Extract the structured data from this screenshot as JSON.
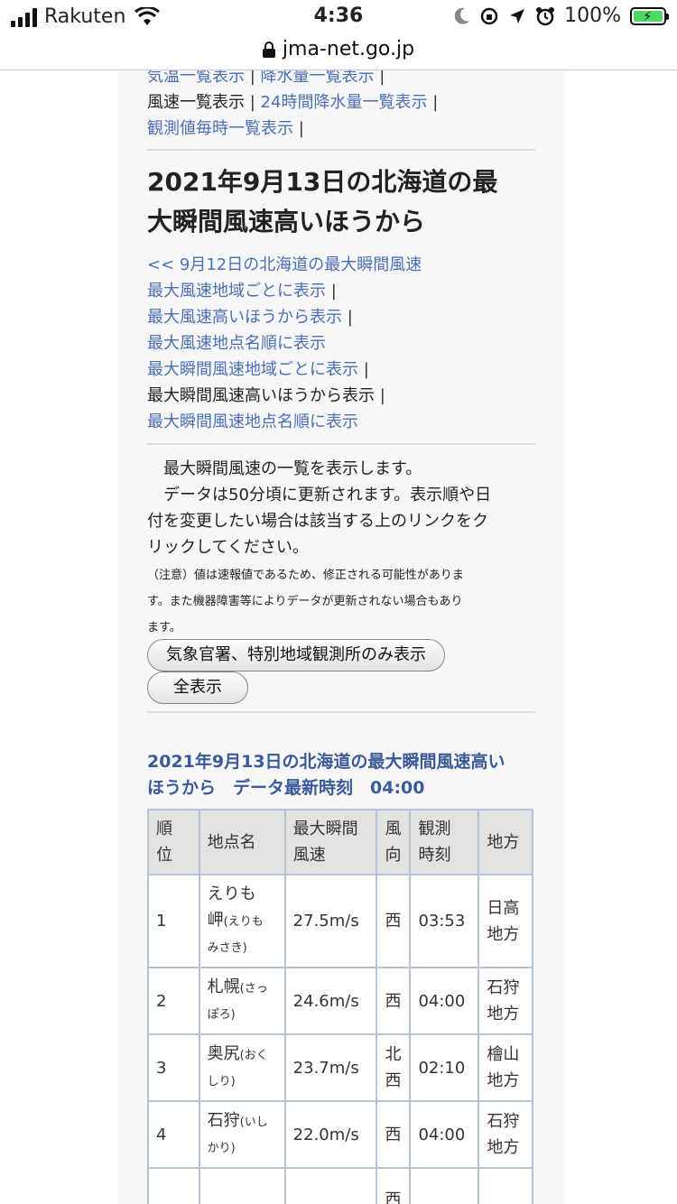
{
  "status": {
    "carrier": "Rakuten",
    "time": "4:36",
    "battery": "100%"
  },
  "url": "jma-net.go.jp",
  "top_nav": [
    [
      {
        "text": "気温一覧表示",
        "link": true
      },
      {
        "text": "|",
        "sep": true
      },
      {
        "text": "降水量一覧表示",
        "link": true
      },
      {
        "text": "|",
        "sep": true
      }
    ],
    [
      {
        "text": "風速一覧表示",
        "link": false
      },
      {
        "text": "|",
        "sep": true
      },
      {
        "text": "24時間降水量一覧表示",
        "link": true
      },
      {
        "text": "|",
        "sep": true
      }
    ],
    [
      {
        "text": "観測値毎時一覧表示",
        "link": true
      },
      {
        "text": "|",
        "sep": true
      }
    ]
  ],
  "title_lines": [
    "2021年9月13日の北海道の最",
    "大瞬間風速高いほうから"
  ],
  "display_nav": [
    {
      "text": "<< 9月12日の北海道の最大瞬間風速",
      "link": true,
      "sep": ""
    },
    {
      "text": "最大風速地域ごとに表示",
      "link": true,
      "sep": "|"
    },
    {
      "text": "最大風速高いほうから表示",
      "link": true,
      "sep": "|"
    },
    {
      "text": "最大風速地点名順に表示",
      "link": true,
      "sep": ""
    },
    {
      "text": "最大瞬間風速地域ごとに表示",
      "link": true,
      "sep": "|"
    },
    {
      "text": "最大瞬間風速高いほうから表示",
      "link": false,
      "sep": "|"
    },
    {
      "text": "最大瞬間風速地点名順に表示",
      "link": true,
      "sep": ""
    }
  ],
  "description_lines": [
    "　最大瞬間風速の一覧を表示します。",
    "　データは50分頃に更新されます。表示順や日",
    "付を変更したい場合は該当する上のリンクをク",
    "リックしてください。"
  ],
  "note_lines": [
    "（注意）値は速報値であるため、修正される可能性がありま",
    "す。また機器障害等によりデータが更新されない場合もあり",
    "ます。"
  ],
  "buttons": {
    "filter": "気象官署、特別地域観測所のみ表示",
    "all": "全表示"
  },
  "table_caption_lines": [
    "2021年9月13日の北海道の最大瞬間風速高い",
    "ほうから　データ最新時刻　04:00"
  ],
  "table": {
    "headers": [
      [
        "順",
        "位"
      ],
      [
        "地点名"
      ],
      [
        "最大瞬間",
        "風速"
      ],
      [
        "風",
        "向"
      ],
      [
        "観測",
        "時刻"
      ],
      [
        "地方"
      ]
    ],
    "rows": [
      {
        "rank": "1",
        "name_lines": [
          "えりも",
          "岬"
        ],
        "kana_lines": [
          "(えりも",
          "みさき)"
        ],
        "speed": "27.5m/s",
        "dir": [
          "西"
        ],
        "time": "03:53",
        "region": [
          "日高",
          "地方"
        ]
      },
      {
        "rank": "2",
        "name_lines": [
          "札幌"
        ],
        "kana_lines": [
          "(さっ",
          "ぽろ)"
        ],
        "speed": "24.6m/s",
        "dir": [
          "西"
        ],
        "time": "04:00",
        "region": [
          "石狩",
          "地方"
        ]
      },
      {
        "rank": "3",
        "name_lines": [
          "奥尻"
        ],
        "kana_lines": [
          "(おく",
          "しり)"
        ],
        "speed": "23.7m/s",
        "dir": [
          "北",
          "西"
        ],
        "time": "02:10",
        "region": [
          "檜山",
          "地方"
        ]
      },
      {
        "rank": "4",
        "name_lines": [
          "石狩"
        ],
        "kana_lines": [
          "(いし",
          "かり)"
        ],
        "speed": "22.0m/s",
        "dir": [
          "西"
        ],
        "time": "04:00",
        "region": [
          "石狩",
          "地方"
        ]
      },
      {
        "rank": "",
        "name_lines": [
          ""
        ],
        "kana_lines": [],
        "speed": "",
        "dir": [
          "西"
        ],
        "time": "",
        "region": [
          ""
        ]
      }
    ]
  }
}
